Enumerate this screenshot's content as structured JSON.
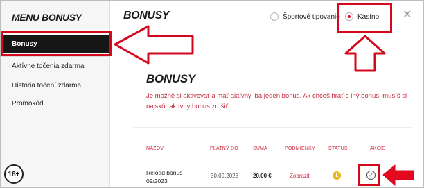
{
  "sidebar": {
    "title": "MENU BONUSY",
    "items": [
      {
        "label": "Bonusy",
        "active": true
      },
      {
        "label": "Aktívne točenia zdarma",
        "active": false
      },
      {
        "label": "História točení zdarma",
        "active": false
      },
      {
        "label": "Promokód",
        "active": false
      }
    ],
    "age_badge": "18+"
  },
  "header": {
    "title": "BONUSY",
    "options": [
      {
        "label": "Športové tipovanie",
        "selected": false
      },
      {
        "label": "Kasíno",
        "selected": true
      }
    ],
    "close_icon": "close-icon"
  },
  "main": {
    "title": "BONUSY",
    "info_text": "Je možné si aktivovať a mať aktívny iba jeden bonus. Ak chceš hrať o iný bonus, musíš si najskôr aktívny bonus zrušiť.",
    "table": {
      "columns": [
        "NÁZOV",
        "PLATNÝ DO",
        "SUMA",
        "PODMIENKY",
        "STATUS",
        "AKCIE"
      ],
      "rows": [
        {
          "name": "Reload bonus 09/2023",
          "valid_to": "30.09.2023",
          "amount": "20,00 €",
          "conditions": "Zobraziť",
          "status_icon": "clock-icon",
          "action_icon": "check-circle-icon"
        }
      ]
    }
  },
  "colors": {
    "accent": "#d12b40",
    "annotation": "#d4081d",
    "sidebar_active": "#161616",
    "status": "#f0b61f"
  }
}
